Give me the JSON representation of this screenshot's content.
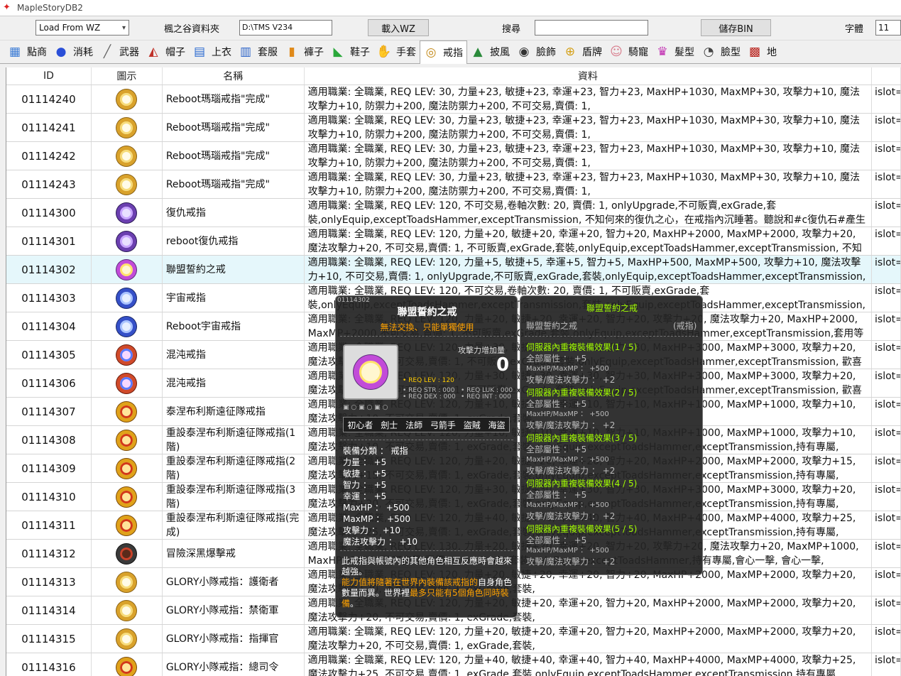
{
  "window": {
    "title": "MapleStoryDB2"
  },
  "toolbar": {
    "load_combo": "Load From WZ",
    "folder_label": "楓之谷資料夾",
    "folder_path": "D:\\TMS V234",
    "load_button": "載入WZ",
    "search_label": "搜尋",
    "search_value": "",
    "save_button": "儲存BIN",
    "font_label": "字體",
    "font_size": "11"
  },
  "tabs": [
    {
      "label": "點商",
      "icon": "shop-icon",
      "color": "#3a7bd5"
    },
    {
      "label": "消耗",
      "icon": "potion-icon",
      "color": "#2a4fd8"
    },
    {
      "label": "武器",
      "icon": "sword-icon",
      "color": "#666"
    },
    {
      "label": "帽子",
      "icon": "hat-icon",
      "color": "#c0322a"
    },
    {
      "label": "上衣",
      "icon": "shirt-icon",
      "color": "#2a6ad0"
    },
    {
      "label": "套服",
      "icon": "overall-icon",
      "color": "#2a62c8"
    },
    {
      "label": "褲子",
      "icon": "pants-icon",
      "color": "#e08a1a"
    },
    {
      "label": "鞋子",
      "icon": "shoes-icon",
      "color": "#2aa83a"
    },
    {
      "label": "手套",
      "icon": "glove-icon",
      "color": "#e6b21a"
    },
    {
      "label": "戒指",
      "icon": "ring-icon",
      "color": "#c38a1a"
    },
    {
      "label": "披風",
      "icon": "cape-icon",
      "color": "#2a8a3a"
    },
    {
      "label": "臉飾",
      "icon": "face-accessory-icon",
      "color": "#333"
    },
    {
      "label": "盾牌",
      "icon": "shield-icon",
      "color": "#d4a018"
    },
    {
      "label": "騎寵",
      "icon": "mount-icon",
      "color": "#d87a8a"
    },
    {
      "label": "髮型",
      "icon": "hair-icon",
      "color": "#c02ab0"
    },
    {
      "label": "臉型",
      "icon": "face-icon",
      "color": "#444"
    },
    {
      "label": "地",
      "icon": "map-icon",
      "color": "#b8201a"
    }
  ],
  "active_tab": "戒指",
  "columns": [
    "ID",
    "圖示",
    "名稱",
    "資料",
    ""
  ],
  "rows": [
    {
      "id": "01114240",
      "icon": "gold",
      "name": "Reboot瑪瑙戒指\"完成\"",
      "data": "適用職業: 全職業, REQ LEV: 30, 力量+23, 敏捷+23, 幸運+23, 智力+23, MaxHP+1030, MaxMP+30, 攻擊力+10, 魔法攻擊力+10, 防禦力+200, 魔法防禦力+200, 不可交易,賣價: 1,",
      "extra": "islot=incST"
    },
    {
      "id": "01114241",
      "icon": "gold",
      "name": "Reboot瑪瑙戒指\"完成\"",
      "data": "適用職業: 全職業, REQ LEV: 30, 力量+23, 敏捷+23, 幸運+23, 智力+23, MaxHP+1030, MaxMP+30, 攻擊力+10, 魔法攻擊力+10, 防禦力+200, 魔法防禦力+200, 不可交易,賣價: 1,",
      "extra": "islot=incST"
    },
    {
      "id": "01114242",
      "icon": "gold",
      "name": "Reboot瑪瑙戒指\"完成\"",
      "data": "適用職業: 全職業, REQ LEV: 30, 力量+23, 敏捷+23, 幸運+23, 智力+23, MaxHP+1030, MaxMP+30, 攻擊力+10, 魔法攻擊力+10, 防禦力+200, 魔法防禦力+200, 不可交易,賣價: 1,",
      "extra": "islot=incST"
    },
    {
      "id": "01114243",
      "icon": "gold",
      "name": "Reboot瑪瑙戒指\"完成\"",
      "data": "適用職業: 全職業, REQ LEV: 30, 力量+23, 敏捷+23, 幸運+23, 智力+23, MaxHP+1030, MaxMP+30, 攻擊力+10, 魔法攻擊力+10, 防禦力+200, 魔法防禦力+200, 不可交易,賣價: 1,",
      "extra": "islot=incST"
    },
    {
      "id": "01114300",
      "icon": "purple",
      "name": "復仇戒指",
      "data": "適用職業: 全職業, REQ LEV: 120, 不可交易,卷軸次數: 20, 賣價: 1, onlyUpgrade,不可販賣,exGrade,套裝,onlyEquip,exceptToadsHammer,exceptTransmission, 不知何來的復仇之心，在戒指內沉睡著。聽說和#c復仇石#產生",
      "extra": "islot=incST"
    },
    {
      "id": "01114301",
      "icon": "purple",
      "name": "reboot復仇戒指",
      "data": "適用職業: 全職業, REQ LEV: 120, 力量+20, 敏捷+20, 幸運+20, 智力+20, MaxHP+2000, MaxMP+2000, 攻擊力+20, 魔法攻擊力+20, 不可交易,賣價: 1, 不可販賣,exGrade,套裝,onlyEquip,exceptToadsHammer,exceptTransmission, 不知何",
      "extra": "islot=incST"
    },
    {
      "id": "01114302",
      "icon": "rainbow",
      "name": "聯盟誓約之戒",
      "data": "適用職業: 全職業, REQ LEV: 120, 力量+5, 敏捷+5, 幸運+5, 智力+5, MaxHP+500, MaxMP+500, 攻擊力+10, 魔法攻擊力+10, 不可交易,賣價: 1, onlyUpgrade,不可販賣,exGrade,套裝,onlyEquip,exceptToadsHammer,exceptTransmission,",
      "extra": "islot=incST",
      "selected": true
    },
    {
      "id": "01114303",
      "icon": "blue",
      "name": "宇宙戒指",
      "data": "適用職業: 全職業, REQ LEV: 120, 不可交易,卷軸次數: 20, 賣價: 1, 不可販賣,exGrade,套裝,onlyEquip,exceptToadsHammer,exceptTransmission,套裝,onlyEquip,exceptToadsHammer,exceptTransmission, 0, onlyUpgrade, 裝有宇宙秩序的戒指。#c聽說",
      "extra": "islot=incST"
    },
    {
      "id": "01114304",
      "icon": "blue",
      "name": "Reboot宇宙戒指",
      "data": "適用職業: 全職業, REQ LEV: 120, 力量+20, 敏捷+20, 幸運+20, 智力+20, 攻擊力+20, 魔法攻擊力+20, MaxHP+2000, MaxMP+2000,不可交易,賣價: 1, 不可販賣,exGrade,套裝,onlyEquip,exceptToadsHammer,exceptTransmission,套用等",
      "extra": "islot=incST"
    },
    {
      "id": "01114305",
      "icon": "red",
      "name": "混沌戒指",
      "data": "適用職業: 全職業, REQ LEV: 120, 力量+30, 敏捷+30, 幸運+30, 智力+30, MaxHP+3000, MaxMP+3000, 攻擊力+20, 魔法攻擊力+20, 不可交易,賣價: 1, 不可販賣,exGrade,套裝,onlyEquip,exceptToadsHammer,exceptTransmission, 歡喜與嘆息",
      "extra": "islot=incST"
    },
    {
      "id": "01114306",
      "icon": "red",
      "name": "混沌戒指",
      "data": "適用職業: 全職業, REQ LEV: 120, 力量+30, 敏捷+30, 幸運+30, 智力+30, MaxHP+3000, MaxMP+3000, 攻擊力+20, 魔法攻擊力+20, 不可交易,賣價: 1, 不可販賣,exGrade,套裝,onlyEquip,exceptToadsHammer,exceptTransmission, 歡喜與嘆息",
      "extra": "islot=incST"
    },
    {
      "id": "01114307",
      "icon": "crown",
      "name": "泰涅布利斯遠征隊戒指",
      "data": "適用職業: 全職業, REQ LEV: 120, 力量+10, 敏捷+10, 幸運+10, 智力+10, MaxHP+1000, MaxMP+1000, 攻擊力+10, 魔法攻擊力+10, 不可交易,賣價: 1, exGrade,套裝,",
      "extra": "islot=incST"
    },
    {
      "id": "01114308",
      "icon": "crown",
      "name": "重設泰涅布利斯遠征隊戒指(1階)",
      "data": "適用職業: 全職業, REQ LEV: 120, 力量+10, 敏捷+10, 幸運+10, 智力+10, MaxHP+1000, MaxMP+1000, 攻擊力+10, 魔法攻擊力+10, 不可交易,賣價: 1, exGrade,套裝,onlyEquip,exceptToadsHammer,exceptTransmission,持有專屬,",
      "extra": "islot=incST"
    },
    {
      "id": "01114309",
      "icon": "crown",
      "name": "重設泰涅布利斯遠征隊戒指(2階)",
      "data": "適用職業: 全職業, REQ LEV: 120, 力量+20, 敏捷+20, 幸運+20, 智力+20, MaxHP+2000, MaxMP+2000, 攻擊力+15, 魔法攻擊力+15, 不可交易,賣價: 1, exGrade,套裝,onlyEquip,exceptToadsHammer,exceptTransmission,持有專屬,",
      "extra": "islot=incST"
    },
    {
      "id": "01114310",
      "icon": "crown",
      "name": "重設泰涅布利斯遠征隊戒指(3階)",
      "data": "適用職業: 全職業, REQ LEV: 120, 力量+30, 敏捷+30, 幸運+30, 智力+30, MaxHP+3000, MaxMP+3000, 攻擊力+20, 魔法攻擊力+20, 不可交易,賣價: 1, exGrade,套裝,onlyEquip,exceptToadsHammer,exceptTransmission,持有專屬,",
      "extra": "islot=incST"
    },
    {
      "id": "01114311",
      "icon": "crown",
      "name": "重設泰涅布利斯遠征隊戒指(完成)",
      "data": "適用職業: 全職業, REQ LEV: 120, 力量+40, 敏捷+40, 幸運+40, 智力+40, MaxHP+4000, MaxMP+4000, 攻擊力+25, 魔法攻擊力+25, 不可交易,賣價: 1, exGrade,套裝,onlyEquip,exceptToadsHammer,exceptTransmission,持有專屬,",
      "extra": "islot=incST"
    },
    {
      "id": "01114312",
      "icon": "dark",
      "name": "冒險深黑爆擊戒",
      "data": "適用職業: 全職業, REQ LEV: 130, 力量+20, 敏捷+20, 幸運+20, 智力+20, 攻擊力+20, 魔法攻擊力+20, MaxMP+1000, MaxHP+1000, 不可交易,賣價: 1, exGrade,套裝,onlyEquip,exceptToadsHammer,持有專屬,會心一擊, 會心一擊,",
      "extra": "islot=reqLE"
    },
    {
      "id": "01114313",
      "icon": "gold",
      "name": "GLORY小隊戒指：護衛者",
      "data": "適用職業: 全職業, REQ LEV: 120, 力量+20, 敏捷+20, 幸運+20, 智力+20, MaxHP+2000, MaxMP+2000, 攻擊力+20, 魔法攻擊力+20, 不可交易,賣價: 1, exGrade,套裝,",
      "extra": "islot=incST"
    },
    {
      "id": "01114314",
      "icon": "gold",
      "name": "GLORY小隊戒指：禁衛軍",
      "data": "適用職業: 全職業, REQ LEV: 120, 力量+20, 敏捷+20, 幸運+20, 智力+20, MaxHP+2000, MaxMP+2000, 攻擊力+20, 魔法攻擊力+20, 不可交易,賣價: 1, exGrade,套裝,",
      "extra": "islot=incST"
    },
    {
      "id": "01114315",
      "icon": "gold",
      "name": "GLORY小隊戒指：指揮官",
      "data": "適用職業: 全職業, REQ LEV: 120, 力量+20, 敏捷+20, 幸運+20, 智力+20, MaxHP+2000, MaxMP+2000, 攻擊力+20, 魔法攻擊力+20, 不可交易,賣價: 1, exGrade,套裝,",
      "extra": "islot=incST"
    },
    {
      "id": "01114316",
      "icon": "crown",
      "name": "GLORY小隊戒指：總司令",
      "data": "適用職業: 全職業, REQ LEV: 120, 力量+40, 敏捷+40, 幸運+40, 智力+40, MaxHP+4000, MaxMP+4000, 攻擊力+25, 魔法攻擊力+25, 不可交易,賣價: 1, exGrade,套裝,onlyEquip,exceptToadsHammer,exceptTransmission,持有專屬,",
      "extra": "islot=incST"
    }
  ],
  "tooltip": {
    "item_id": "01114302",
    "name": "聯盟誓約之戒",
    "tradeable": "無法交換、只能單獨使用",
    "attack_increase_label": "攻擊力增加量",
    "attack_increase_value": "0",
    "req_lev": "• REQ LEV : 120",
    "req_str": "• REQ STR : 000",
    "req_luk": "• REQ LUK : 000",
    "req_dex": "• REQ DEX : 000",
    "req_int": "• REQ INT : 000",
    "jobs": [
      "初心者",
      "劍士",
      "法師",
      "弓箭手",
      "盜賊",
      "海盜"
    ],
    "stats": [
      "裝備分類 ： 戒指",
      "力量 ： +5",
      "敏捷 ： +5",
      "智力 ： +5",
      "幸運 ： +5",
      "MaxHP ： +500",
      "MaxMP ： +500",
      "攻擊力 ： +10",
      "魔法攻擊力 ： +10"
    ],
    "desc1": "此戒指與帳號內的其他角色相互反應時會越來越強。",
    "desc2_orange": "能力值將隨著在世界內裝備該戒指的",
    "desc2_white": "自身角色數量而異。世界裡",
    "desc2_orange_b": "最多只能有5個角色同時裝備",
    "desc2_end": "。"
  },
  "set_tooltip": {
    "title": "聯盟誓約之戒",
    "item": "聯盟誓約之戒",
    "item_type": "(戒指)",
    "effects": [
      {
        "header": "伺服器內重複裝備效果(1 / 5)",
        "l1": "全部屬性 ： +5",
        "l2": "MaxHP/MaxMP ： +500",
        "l3": "攻擊/魔法攻擊力 ： +2"
      },
      {
        "header": "伺服器內重複裝備效果(2 / 5)",
        "l1": "全部屬性 ： +5",
        "l2": "MaxHP/MaxMP ： +500",
        "l3": "攻擊/魔法攻擊力 ： +2"
      },
      {
        "header": "伺服器內重複裝備效果(3 / 5)",
        "l1": "全部屬性 ： +5",
        "l2": "MaxHP/MaxMP ： +500",
        "l3": "攻擊/魔法攻擊力 ： +2"
      },
      {
        "header": "伺服器內重複裝備效果(4 / 5)",
        "l1": "全部屬性 ： +5",
        "l2": "MaxHP/MaxMP ： +500",
        "l3": "攻擊/魔法攻擊力 ： +2"
      },
      {
        "header": "伺服器內重複裝備效果(5 / 5)",
        "l1": "全部屬性 ： +5",
        "l2": "MaxHP/MaxMP ： +500",
        "l3": "攻擊/魔法攻擊力 ： +2"
      }
    ]
  }
}
